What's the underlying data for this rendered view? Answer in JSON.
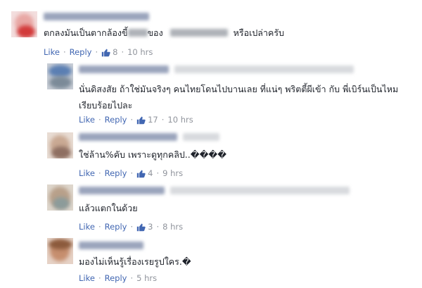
{
  "comments": [
    {
      "text_before": "ตกลงมันเป็นตากล้องขี้",
      "text_mid": "ของ",
      "text_after": "หรือเปล่าครับ",
      "like_label": "Like",
      "reply_label": "Reply",
      "like_count": "8",
      "time": "10 hrs"
    },
    {
      "text_line1": "นั่นดิสงสัย ถ้าใช่มันจริงๆ คนไทยโดนไปบานเลย ที่แน่ๆ พริตตี้ผีเข้า กับ พี่เบิร์นเป็นไหม",
      "text_line2": "เรียบร้อยไปละ",
      "like_label": "Like",
      "reply_label": "Reply",
      "like_count": "17",
      "time": "10 hrs"
    },
    {
      "text": "ใช่ล้าน%คับ เพราะดูทุกคลิป..����",
      "like_label": "Like",
      "reply_label": "Reply",
      "like_count": "4",
      "time": "9 hrs"
    },
    {
      "text": "แล้วแตกในด้วย",
      "like_label": "Like",
      "reply_label": "Reply",
      "like_count": "3",
      "time": "8 hrs"
    },
    {
      "text": "มองไม่เห็นรู้เรื่องเรยรูปใคร.�",
      "like_label": "Like",
      "reply_label": "Reply",
      "time": "5 hrs"
    }
  ],
  "colors": {
    "link": "#4267b2",
    "meta": "#90949c",
    "text": "#1d2129"
  },
  "icons": {
    "like": "thumbs-up-icon"
  }
}
